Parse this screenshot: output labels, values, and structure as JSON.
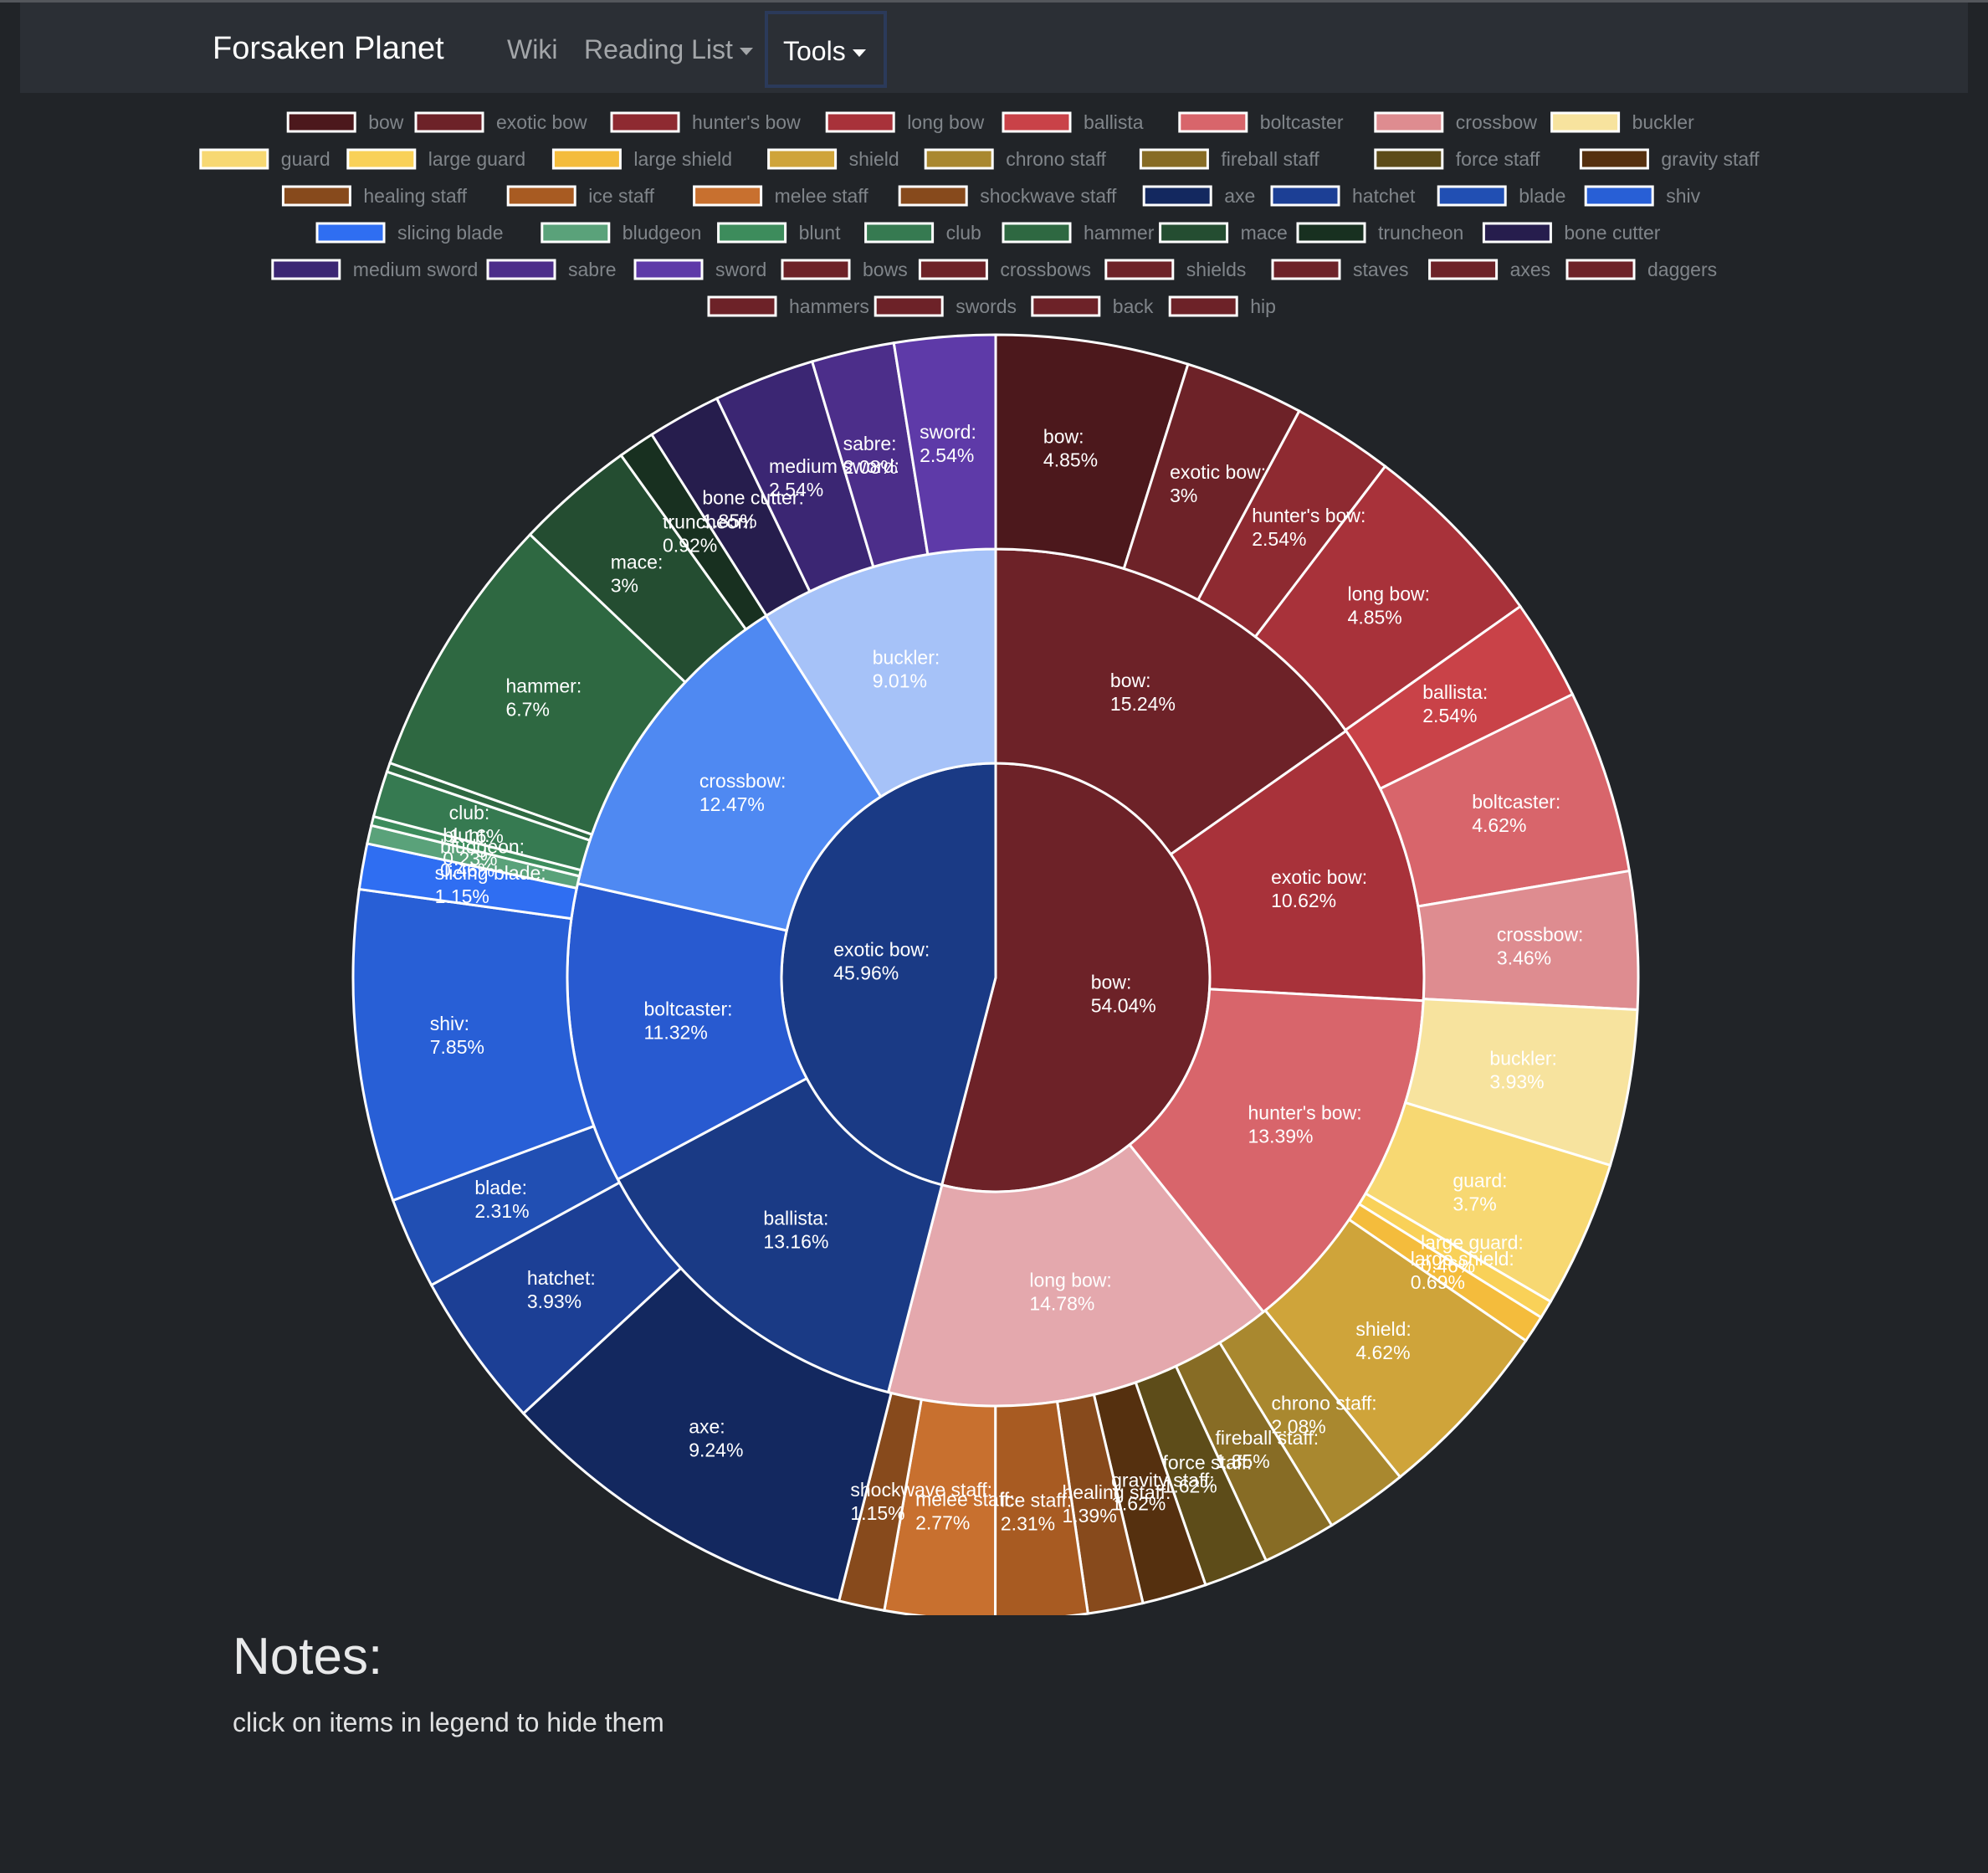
{
  "navbar": {
    "brand": "Forsaken Planet",
    "links": [
      {
        "label": "Wiki"
      },
      {
        "label": "Reading List"
      },
      {
        "label": "Tools"
      }
    ]
  },
  "notes": {
    "title": "Notes:",
    "text": "click on items in legend to hide them"
  },
  "chart_data": {
    "type": "sunburst",
    "value_unit": "%",
    "legend": [
      {
        "name": "bow",
        "color": "#4c181c"
      },
      {
        "name": "exotic bow",
        "color": "#6d2228"
      },
      {
        "name": "hunter's bow",
        "color": "#8e2a31"
      },
      {
        "name": "long bow",
        "color": "#a8323a"
      },
      {
        "name": "ballista",
        "color": "#c94248"
      },
      {
        "name": "boltcaster",
        "color": "#d8656b"
      },
      {
        "name": "crossbow",
        "color": "#de8c90"
      },
      {
        "name": "buckler",
        "color": "#f7e39e"
      },
      {
        "name": "guard",
        "color": "#f7d872"
      },
      {
        "name": "large guard",
        "color": "#f9d158"
      },
      {
        "name": "large shield",
        "color": "#f4bc3c"
      },
      {
        "name": "shield",
        "color": "#cfa43a"
      },
      {
        "name": "chrono staff",
        "color": "#a9882f"
      },
      {
        "name": "fireball staff",
        "color": "#876c25"
      },
      {
        "name": "force staff",
        "color": "#5d4c19"
      },
      {
        "name": "gravity staff",
        "color": "#55300f"
      },
      {
        "name": "healing staff",
        "color": "#874a1c"
      },
      {
        "name": "ice staff",
        "color": "#a85b22"
      },
      {
        "name": "melee staff",
        "color": "#c8702f"
      },
      {
        "name": "shockwave staff",
        "color": "#874a1c"
      },
      {
        "name": "axe",
        "color": "#13285f"
      },
      {
        "name": "hatchet",
        "color": "#1c3f95"
      },
      {
        "name": "blade",
        "color": "#214fb3"
      },
      {
        "name": "shiv",
        "color": "#285fd6"
      },
      {
        "name": "slicing blade",
        "color": "#2f6ef2"
      },
      {
        "name": "bludgeon",
        "color": "#5aa27a"
      },
      {
        "name": "blunt",
        "color": "#3d8c5c"
      },
      {
        "name": "club",
        "color": "#367a51"
      },
      {
        "name": "hammer",
        "color": "#2e6841"
      },
      {
        "name": "mace",
        "color": "#244d31"
      },
      {
        "name": "truncheon",
        "color": "#183020"
      },
      {
        "name": "bone cutter",
        "color": "#261d4d"
      },
      {
        "name": "medium sword",
        "color": "#3b2673"
      },
      {
        "name": "sabre",
        "color": "#4c2e8a"
      },
      {
        "name": "sword",
        "color": "#5e3aa8"
      },
      {
        "name": "bows",
        "color": "#6d2228"
      },
      {
        "name": "crossbows",
        "color": "#6d2228"
      },
      {
        "name": "shields",
        "color": "#6d2228"
      },
      {
        "name": "staves",
        "color": "#6d2228"
      },
      {
        "name": "axes",
        "color": "#6d2228"
      },
      {
        "name": "daggers",
        "color": "#6d2228"
      },
      {
        "name": "hammers",
        "color": "#6d2228"
      },
      {
        "name": "swords",
        "color": "#6d2228"
      },
      {
        "name": "back",
        "color": "#6d2228"
      },
      {
        "name": "hip",
        "color": "#6d2228"
      }
    ],
    "rings": [
      [
        {
          "label": "bow",
          "value": 54.04,
          "color": "#6d2228"
        },
        {
          "label": "exotic bow",
          "value": 45.96,
          "color": "#1a3a85"
        }
      ],
      [
        {
          "label": "bow",
          "value": 15.24,
          "color": "#6d2228"
        },
        {
          "label": "exotic bow",
          "value": 10.62,
          "color": "#a8323a"
        },
        {
          "label": "hunter's bow",
          "value": 13.39,
          "color": "#d8656b"
        },
        {
          "label": "long bow",
          "value": 14.78,
          "color": "#e4a8ad"
        },
        {
          "label": "ballista",
          "value": 13.16,
          "color": "#1a3a85"
        },
        {
          "label": "boltcaster",
          "value": 11.32,
          "color": "#285ad0"
        },
        {
          "label": "crossbow",
          "value": 12.47,
          "color": "#4f89f2"
        },
        {
          "label": "buckler",
          "value": 9.01,
          "color": "#a6c2f8"
        }
      ],
      [
        {
          "label": "bow",
          "value": 4.85,
          "color": "#4c181c"
        },
        {
          "label": "exotic bow",
          "value": 3,
          "color": "#6d2228"
        },
        {
          "label": "hunter's bow",
          "value": 2.54,
          "color": "#8e2a31"
        },
        {
          "label": "long bow",
          "value": 4.85,
          "color": "#a8323a"
        },
        {
          "label": "ballista",
          "value": 2.54,
          "color": "#c94248"
        },
        {
          "label": "boltcaster",
          "value": 4.62,
          "color": "#d8656b"
        },
        {
          "label": "crossbow",
          "value": 3.46,
          "color": "#de8c90"
        },
        {
          "label": "buckler",
          "value": 3.93,
          "color": "#f7e39e"
        },
        {
          "label": "guard",
          "value": 3.7,
          "color": "#f7d872"
        },
        {
          "label": "large guard",
          "value": 0.46,
          "color": "#f9d158"
        },
        {
          "label": "large shield",
          "value": 0.69,
          "color": "#f4bc3c"
        },
        {
          "label": "shield",
          "value": 4.62,
          "color": "#cfa43a"
        },
        {
          "label": "chrono staff",
          "value": 2.08,
          "color": "#a9882f"
        },
        {
          "label": "fireball staff",
          "value": 1.85,
          "color": "#876c25"
        },
        {
          "label": "force staff",
          "value": 1.62,
          "color": "#5d4c19"
        },
        {
          "label": "gravity staff",
          "value": 1.62,
          "color": "#55300f"
        },
        {
          "label": "healing staff",
          "value": 1.39,
          "color": "#874a1c"
        },
        {
          "label": "ice staff",
          "value": 2.31,
          "color": "#a85b22"
        },
        {
          "label": "melee staff",
          "value": 2.77,
          "color": "#c8702f"
        },
        {
          "label": "shockwave staff",
          "value": 1.15,
          "color": "#874a1c"
        },
        {
          "label": "axe",
          "value": 9.24,
          "color": "#13285f"
        },
        {
          "label": "hatchet",
          "value": 3.93,
          "color": "#1c3f95"
        },
        {
          "label": "blade",
          "value": 2.31,
          "color": "#214fb3"
        },
        {
          "label": "shiv",
          "value": 7.85,
          "color": "#285fd6"
        },
        {
          "label": "slicing blade",
          "value": 1.15,
          "color": "#2f6ef2"
        },
        {
          "label": "bludgeon",
          "value": 0.46,
          "color": "#5aa27a"
        },
        {
          "label": "blunt",
          "value": 0.23,
          "color": "#3d8c5c"
        },
        {
          "label": "club",
          "value": 1.16,
          "color": "#367a51"
        },
        {
          "label": "",
          "value": 0.23,
          "color": "#2e6841"
        },
        {
          "label": "hammer",
          "value": 6.7,
          "color": "#2e6841"
        },
        {
          "label": "mace",
          "value": 3,
          "color": "#244d31"
        },
        {
          "label": "truncheon",
          "value": 0.92,
          "color": "#183020"
        },
        {
          "label": "bone cutter",
          "value": 1.85,
          "color": "#261d4d"
        },
        {
          "label": "medium sword",
          "value": 2.54,
          "color": "#3b2673"
        },
        {
          "label": "sabre",
          "value": 2.08,
          "color": "#4c2e8a"
        },
        {
          "label": "sword",
          "value": 2.54,
          "color": "#5e3aa8"
        }
      ]
    ]
  }
}
